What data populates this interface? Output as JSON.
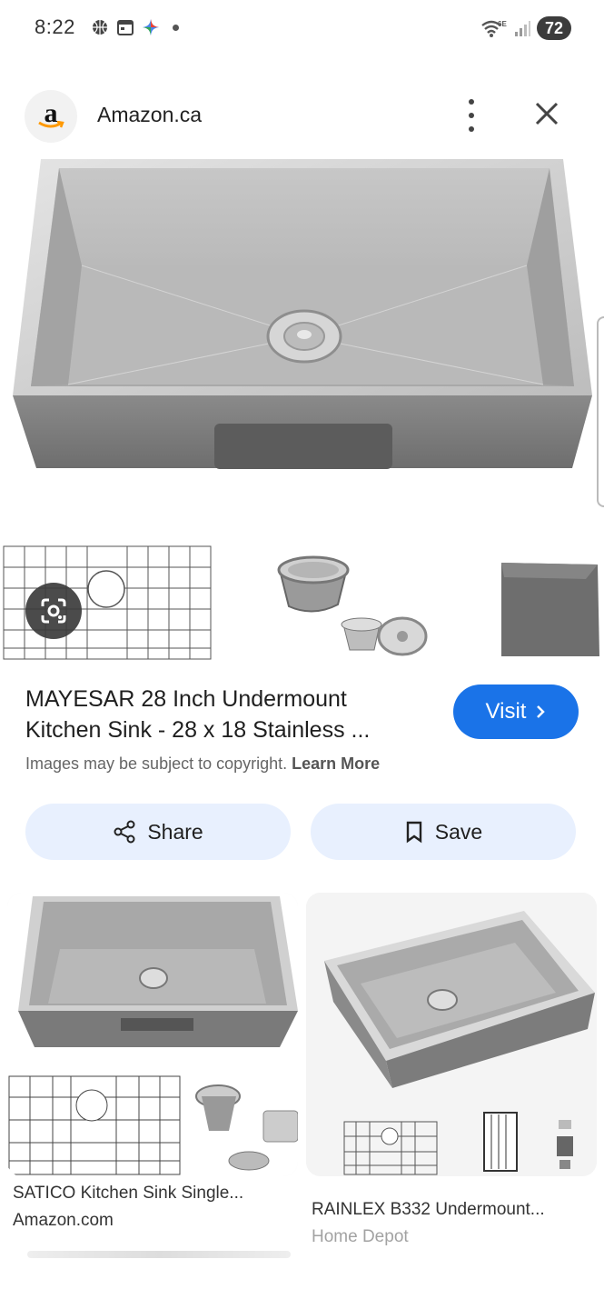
{
  "status": {
    "time": "8:22",
    "network": "6E",
    "battery": "72"
  },
  "source": {
    "logo_letter": "a",
    "name": "Amazon.ca"
  },
  "result": {
    "title_line1": "MAYESAR 28 Inch Undermount",
    "title_line2": "Kitchen Sink - 28 x 18 Stainless ...",
    "visit_label": "Visit",
    "copyright_text": "Images may be subject to copyright.",
    "learn_more": "Learn More"
  },
  "actions": {
    "share_label": "Share",
    "save_label": "Save"
  },
  "related": [
    {
      "title": "SATICO Kitchen Sink Single...",
      "source": "Amazon.com"
    },
    {
      "title": "RAINLEX B332 Undermount...",
      "source": "Home Depot"
    }
  ],
  "colors": {
    "accent": "#1a73e8",
    "chip_bg": "#e8f0fe"
  }
}
